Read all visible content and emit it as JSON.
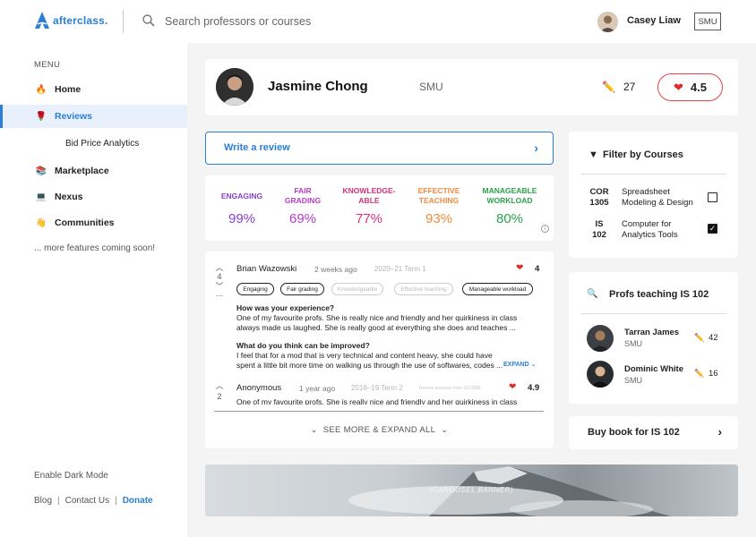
{
  "app": {
    "logo_text": "afterclass.",
    "brand_color": "#2b7fd6"
  },
  "search": {
    "placeholder": "Search professors or courses"
  },
  "user": {
    "name": "Casey Liaw",
    "school": "SMU"
  },
  "sidebar": {
    "menu_label": "MENU",
    "items": [
      {
        "emoji": "🔥",
        "label": "Home"
      },
      {
        "emoji": "🌹",
        "label": "Reviews"
      },
      {
        "emoji": "📚",
        "label": "Marketplace"
      },
      {
        "emoji": "💻",
        "label": "Nexus"
      },
      {
        "emoji": "👋",
        "label": "Communities"
      }
    ],
    "sub_item": "Bid Price Analytics",
    "more_features": "... more features coming soon!",
    "dark_mode": "Enable Dark Mode",
    "footer": {
      "blog": "Blog",
      "contact": "Contact Us",
      "donate": "Donate",
      "sep": "|"
    }
  },
  "professor": {
    "name": "Jasmine Chong",
    "school": "SMU",
    "review_count": "27",
    "rating": "4.5"
  },
  "write_review": {
    "label": "Write a review"
  },
  "metrics": [
    {
      "label": "ENGAGING",
      "value": "99%",
      "color": "#8a3fd1"
    },
    {
      "label": "FAIR GRADING",
      "value": "69%",
      "color": "#b93cc8"
    },
    {
      "label": "KNOWLEDGE-ABLE",
      "value": "77%",
      "color": "#d6317a"
    },
    {
      "label": "EFFECTIVE TEACHING",
      "value": "93%",
      "color": "#ef8a3c"
    },
    {
      "label": "MANAGEABLE WORKLOAD",
      "value": "80%",
      "color": "#2aa24b"
    }
  ],
  "reviews": [
    {
      "votes": "4",
      "author": "Brian Wazowski",
      "time": "2 weeks ago",
      "term": "2020–21 Term 1",
      "score": "4",
      "tags": [
        {
          "label": "Engaging",
          "on": true
        },
        {
          "label": "Fair grading",
          "on": true
        },
        {
          "label": "Knowledgeable",
          "on": false
        },
        {
          "label": "Effective teaching",
          "on": false
        },
        {
          "label": "Manageable workload",
          "on": true
        }
      ],
      "q1": "How was your experience?",
      "a1": "One of my favourite profs. She is really nice and friendly and her quirkiness in class always made us laughed. She is really good at everything she does and teaches ...",
      "q2": "What do you think can be improved?",
      "a2": "I feel that for a mod that is very technical and content heavy, she could have spent a little bit more time on walking us through the use of softwares, codes ...",
      "expand": "EXPAND"
    },
    {
      "votes": "2",
      "author": "Anonymous",
      "time": "1 year ago",
      "term": "2018–19 Term 2",
      "course_note": "Review previous from IS102ML",
      "score": "4.9",
      "a1": "One of my favourite profs. She is really nice and friendly and her quirkiness in class"
    }
  ],
  "see_more": "SEE MORE & EXPAND ALL",
  "filter": {
    "title": "Filter by Courses",
    "courses": [
      {
        "code": "COR 1305",
        "name": "Spreadsheet Modeling & Design",
        "checked": false
      },
      {
        "code": "IS 102",
        "name": "Computer for Analytics Tools",
        "checked": true
      }
    ]
  },
  "profs_teaching": {
    "title": "Profs teaching IS 102",
    "profs": [
      {
        "name": "Tarran James",
        "school": "SMU",
        "count": "42"
      },
      {
        "name": "Dominic White",
        "school": "SMU",
        "count": "16"
      }
    ]
  },
  "buy_book": {
    "label": "Buy book for IS 102"
  },
  "banner": {
    "label": "(CAROUSEL BANNER)"
  }
}
